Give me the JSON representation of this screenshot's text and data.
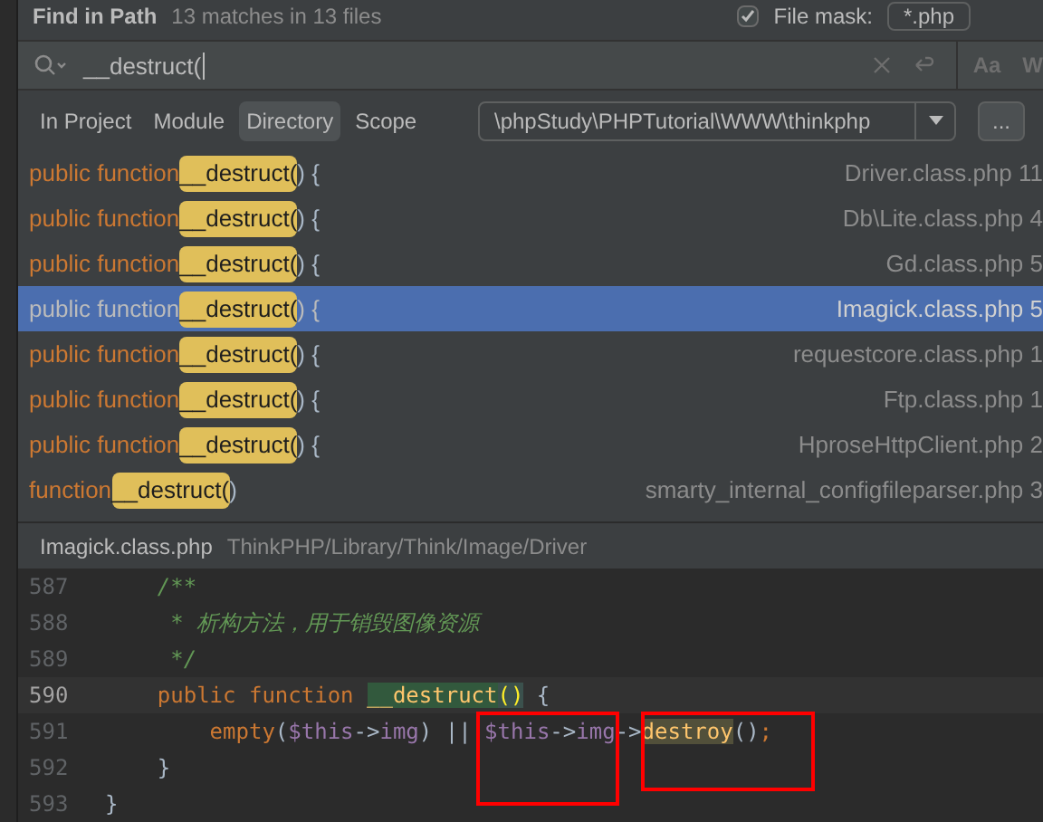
{
  "dialog": {
    "title": "Find in Path",
    "summary": "13 matches in 13 files",
    "file_mask": {
      "label": "File mask:",
      "checked": true,
      "value": "*.php"
    }
  },
  "search": {
    "value": "__destruct(",
    "case_toggle": "Aa",
    "word_toggle": "W"
  },
  "scopes": [
    {
      "label": "In Project",
      "selected": false
    },
    {
      "label": "Module",
      "selected": false
    },
    {
      "label": "Directory",
      "selected": true
    },
    {
      "label": "Scope",
      "selected": false
    }
  ],
  "directory": {
    "value": "\\phpStudy\\PHPTutorial\\WWW\\thinkphp",
    "browse": "..."
  },
  "results": [
    {
      "prefix": "public function ",
      "match": "__destruct(",
      "suffix": ") {",
      "file": "Driver.class.php 11",
      "selected": false
    },
    {
      "prefix": "public function ",
      "match": "__destruct(",
      "suffix": ") {",
      "file": "Db\\Lite.class.php 4",
      "selected": false
    },
    {
      "prefix": "public function ",
      "match": "__destruct(",
      "suffix": ") {",
      "file": "Gd.class.php 5",
      "selected": false
    },
    {
      "prefix": "public function ",
      "match": "__destruct(",
      "suffix": ") {",
      "file": "Imagick.class.php 5",
      "selected": true
    },
    {
      "prefix": "public function ",
      "match": "__destruct(",
      "suffix": ") {",
      "file": "requestcore.class.php 1",
      "selected": false
    },
    {
      "prefix": "public function ",
      "match": "__destruct(",
      "suffix": ") {",
      "file": "Ftp.class.php 1",
      "selected": false
    },
    {
      "prefix": "public function ",
      "match": "__destruct(",
      "suffix": ") {",
      "file": "HproseHttpClient.php 2",
      "selected": false
    },
    {
      "prefix": "function ",
      "match": "__destruct(",
      "suffix": ")",
      "file": "smarty_internal_configfileparser.php 3",
      "selected": false
    }
  ],
  "preview": {
    "file": "Imagick.class.php",
    "path": "ThinkPHP/Library/Think/Image/Driver",
    "lines": [
      {
        "number": "587",
        "current": false,
        "tokens": [
          {
            "kind": "comment",
            "text": "    /**"
          }
        ]
      },
      {
        "number": "588",
        "current": false,
        "tokens": [
          {
            "kind": "comment",
            "text": "     * 析构方法，用于销毁图像资源"
          }
        ]
      },
      {
        "number": "589",
        "current": false,
        "tokens": [
          {
            "kind": "comment",
            "text": "     */"
          }
        ]
      },
      {
        "number": "590",
        "current": true,
        "tokens": [
          {
            "kind": "keyword",
            "text": "    public function "
          },
          {
            "kind": "match",
            "text": "__destruct"
          },
          {
            "kind": "brace",
            "text": "()"
          },
          {
            "kind": "plain",
            "text": " {"
          }
        ]
      },
      {
        "number": "591",
        "current": false,
        "tokens": [
          {
            "kind": "func",
            "text": "        empty"
          },
          {
            "kind": "plain",
            "text": "("
          },
          {
            "kind": "var",
            "text": "$this"
          },
          {
            "kind": "plain",
            "text": "->"
          },
          {
            "kind": "prop",
            "text": "img"
          },
          {
            "kind": "plain",
            "text": ") || "
          },
          {
            "kind": "var",
            "text": "$this"
          },
          {
            "kind": "plain",
            "text": "->"
          },
          {
            "kind": "prop",
            "text": "img"
          },
          {
            "kind": "plain",
            "text": "->"
          },
          {
            "kind": "usage",
            "text": "destroy"
          },
          {
            "kind": "plain",
            "text": "()"
          },
          {
            "kind": "keyword",
            "text": ";"
          }
        ]
      },
      {
        "number": "592",
        "current": false,
        "tokens": [
          {
            "kind": "plain",
            "text": "    }"
          }
        ]
      },
      {
        "number": "593",
        "current": false,
        "tokens": [
          {
            "kind": "plain",
            "text": "}"
          }
        ]
      }
    ]
  }
}
